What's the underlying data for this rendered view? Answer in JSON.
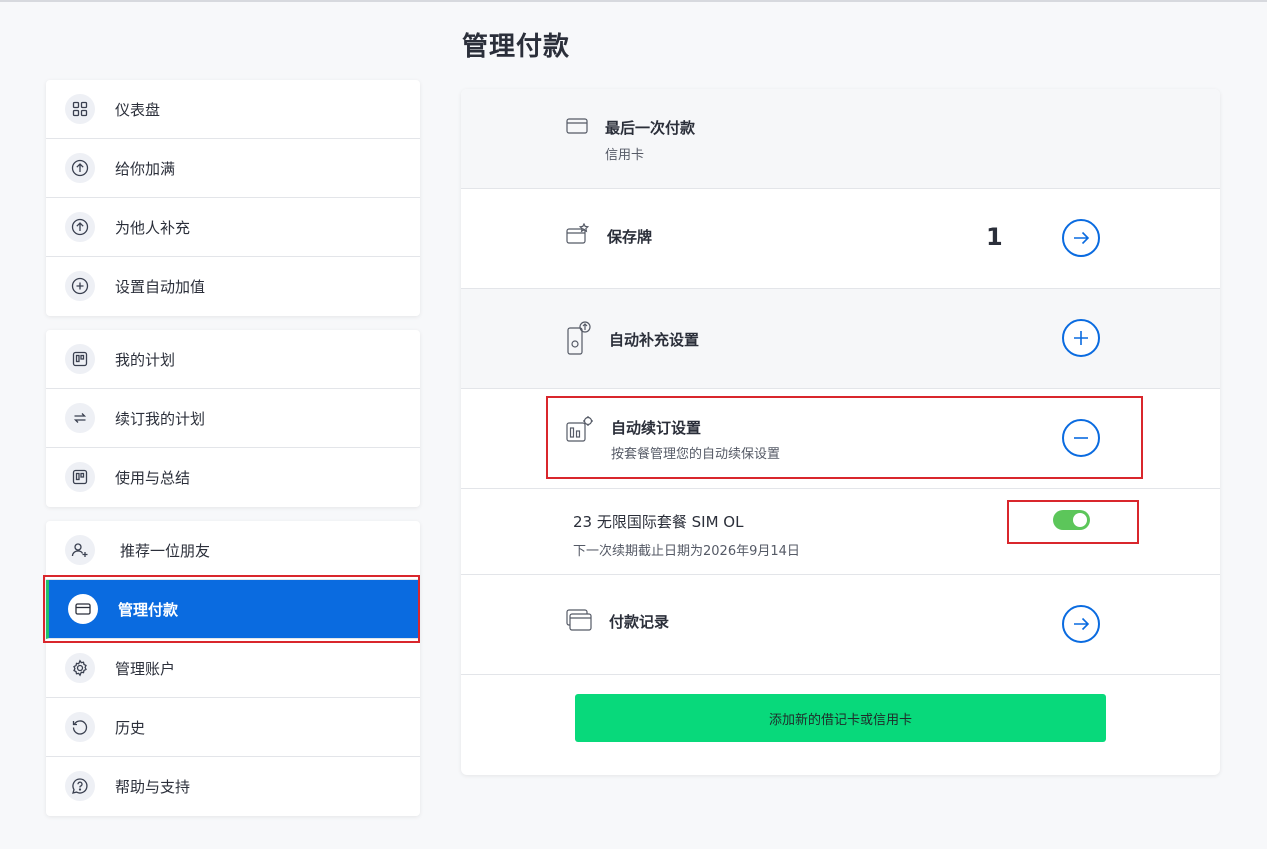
{
  "page_title": "管理付款",
  "sidebar": {
    "group1": [
      {
        "label": "仪表盘",
        "icon": "grid-icon"
      },
      {
        "label": "给你加满",
        "icon": "arrow-up-circle-icon"
      },
      {
        "label": "为他人补充",
        "icon": "arrow-up-circle-icon"
      },
      {
        "label": "设置自动加值",
        "icon": "plus-circle-icon"
      }
    ],
    "group2": [
      {
        "label": "我的计划",
        "icon": "plan-icon"
      },
      {
        "label": "续订我的计划",
        "icon": "repeat-icon"
      },
      {
        "label": "使用与总结",
        "icon": "plan-icon"
      }
    ],
    "group3": [
      {
        "label": "推荐一位朋友",
        "icon": "add-user-icon"
      },
      {
        "label": "管理付款",
        "icon": "card-icon",
        "active": true
      },
      {
        "label": "管理账户",
        "icon": "gear-icon"
      },
      {
        "label": "历史",
        "icon": "history-icon"
      },
      {
        "label": "帮助与支持",
        "icon": "help-chat-icon"
      }
    ]
  },
  "main": {
    "last_payment": {
      "title": "最后一次付款",
      "subtitle": "信用卡"
    },
    "saved_cards": {
      "title": "保存牌",
      "count": "1"
    },
    "auto_topup": {
      "title": "自动补充设置"
    },
    "auto_renew": {
      "title": "自动续订设置",
      "subtitle": "按套餐管理您的自动续保设置"
    },
    "plan_row": {
      "title": "23 无限国际套餐 SIM OL",
      "subtitle": "下一次续期截止日期为2026年9月14日",
      "toggle_on": true
    },
    "payment_history": {
      "title": "付款记录"
    },
    "add_card_button": "添加新的借记卡或信用卡"
  },
  "colors": {
    "accent": "#0a6be0",
    "toggle": "#5cc65a",
    "add_button": "#08d97b",
    "highlight_box": "#d9262c"
  }
}
